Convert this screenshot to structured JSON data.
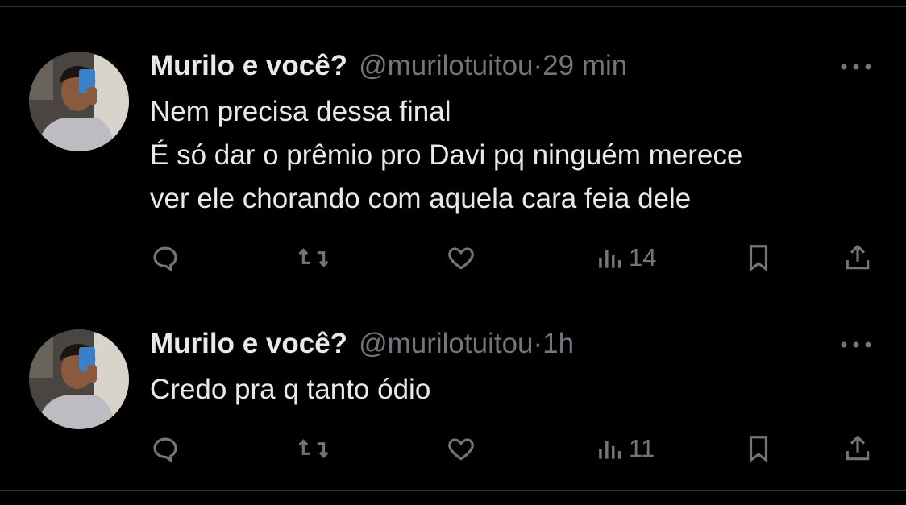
{
  "tweets": [
    {
      "author_name": "Murilo e você?",
      "handle": "@murilotuitou",
      "separator": "·",
      "time": "29 min",
      "lines": [
        "Nem precisa dessa final",
        "É só dar o prêmio pro Davi pq ninguém merece",
        "ver ele chorando com aquela cara feia dele"
      ],
      "views": "14",
      "icons": [
        "reply-icon",
        "retweet-icon",
        "like-icon",
        "views-icon",
        "bookmark-icon",
        "share-icon",
        "more-icon"
      ]
    },
    {
      "author_name": "Murilo e você?",
      "handle": "@murilotuitou",
      "separator": "·",
      "time": "1h",
      "lines": [
        "Credo pra q tanto ódio"
      ],
      "views": "11",
      "icons": [
        "reply-icon",
        "retweet-icon",
        "like-icon",
        "views-icon",
        "bookmark-icon",
        "share-icon",
        "more-icon"
      ]
    }
  ],
  "colors": {
    "background": "#000000",
    "text": "#e7e9ea",
    "muted": "#71767b",
    "divider": "#2f3336"
  }
}
